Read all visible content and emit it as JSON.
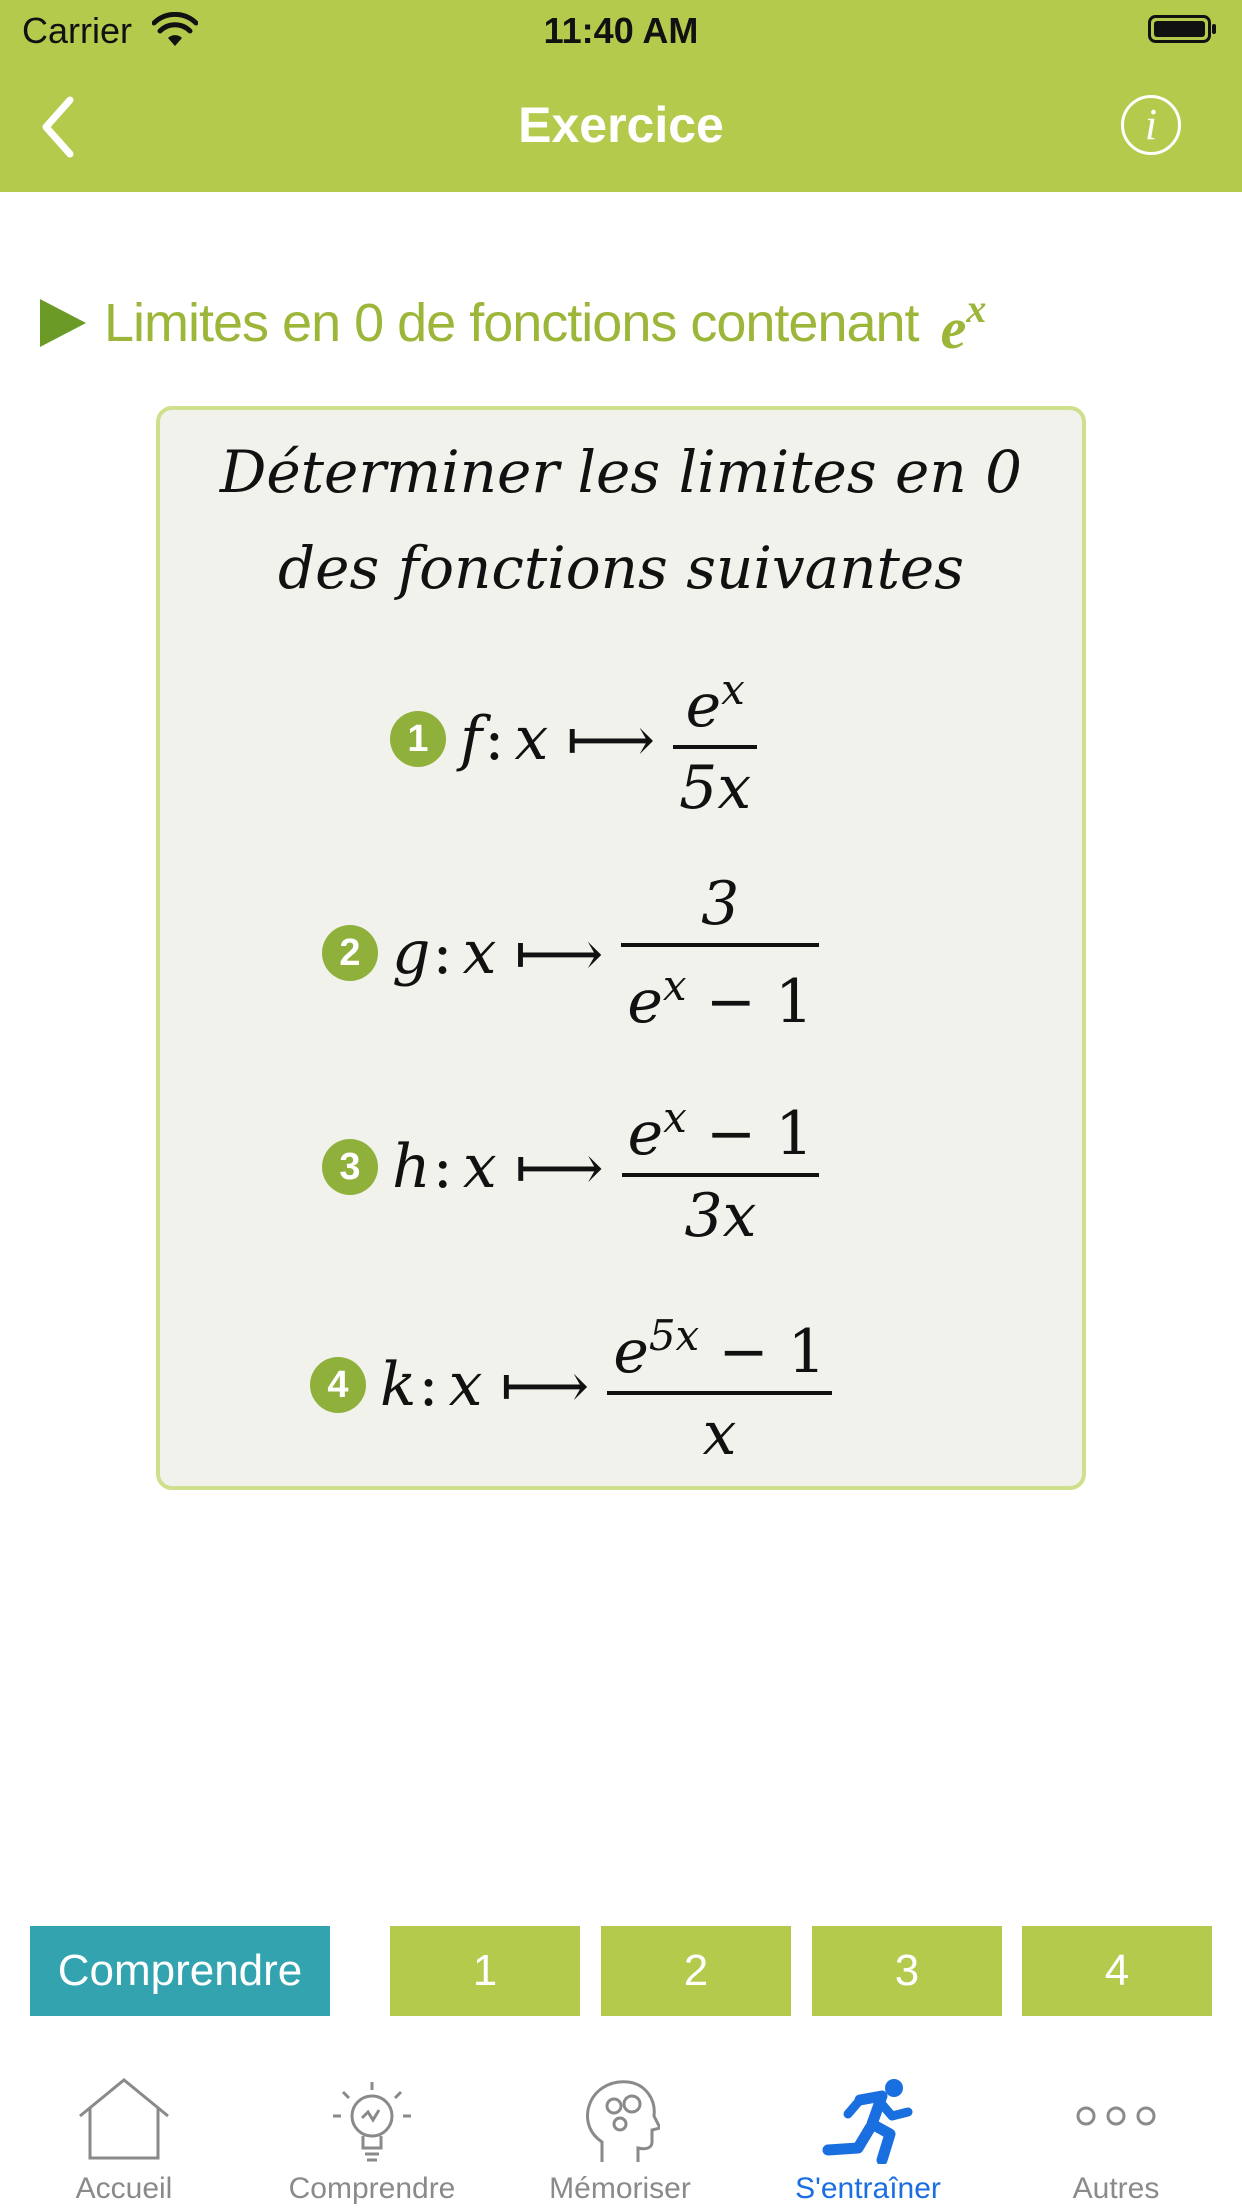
{
  "status_bar": {
    "carrier": "Carrier",
    "time": "11:40 AM"
  },
  "nav": {
    "title": "Exercice",
    "info_label": "i"
  },
  "section": {
    "heading": "Limites en 0 de fonctions contenant",
    "heading_math_base": "e",
    "heading_math_exp": "x"
  },
  "exercise": {
    "prompt_line1": "Déterminer les limites en 0",
    "prompt_line2": "des fonctions suivantes",
    "items": [
      {
        "number": "1",
        "name": "f",
        "var": "x",
        "arrow": "⟼",
        "numerator_base": "e",
        "numerator_exp": "x",
        "numerator_tail": "",
        "denominator": "5x"
      },
      {
        "number": "2",
        "name": "g",
        "var": "x",
        "arrow": "⟼",
        "numerator": "3",
        "denominator_base": "e",
        "denominator_exp": "x",
        "denominator_tail": " − 1"
      },
      {
        "number": "3",
        "name": "h",
        "var": "x",
        "arrow": "⟼",
        "numerator_base": "e",
        "numerator_exp": "x",
        "numerator_tail": " − 1",
        "denominator": "3x"
      },
      {
        "number": "4",
        "name": "k",
        "var": "x",
        "arrow": "⟼",
        "numerator_base": "e",
        "numerator_exp": "5x",
        "numerator_tail": " − 1",
        "denominator": "x"
      }
    ]
  },
  "actions": {
    "comprendre": "Comprendre",
    "pages": [
      "1",
      "2",
      "3",
      "4"
    ]
  },
  "tabs": [
    {
      "label": "Accueil",
      "icon": "house-icon"
    },
    {
      "label": "Comprendre",
      "icon": "lightbulb-icon"
    },
    {
      "label": "Mémoriser",
      "icon": "brain-gears-icon"
    },
    {
      "label": "S'entraîner",
      "icon": "runner-icon",
      "active": true
    },
    {
      "label": "Autres",
      "icon": "more-dots-icon"
    }
  ],
  "colors": {
    "brand": "#b4ca4d",
    "active_tab": "#1a6fe0",
    "comprendre_button": "#33a3b0"
  }
}
